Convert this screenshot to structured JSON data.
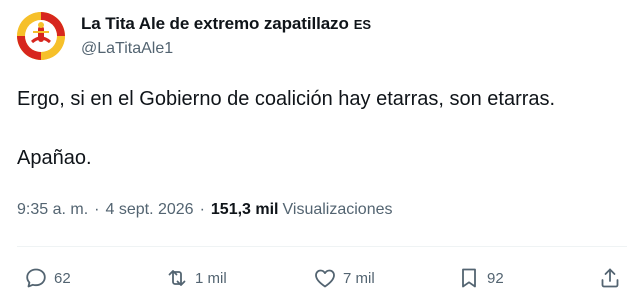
{
  "author": {
    "display_name": "La Tita Ale de extremo zapatillazo",
    "language_badge": "ES",
    "handle": "@LaTitaAle1"
  },
  "tweet": {
    "paragraphs": [
      "Ergo, si en el Gobierno de coalición hay etarras, son etarras.",
      "Apañao."
    ],
    "time": "9:35 a. m.",
    "separator": "·",
    "date": "4 sept. 2026",
    "views_count": "151,3 mil",
    "views_label": "Visualizaciones"
  },
  "actions": {
    "replies": "62",
    "reposts": "1 mil",
    "likes": "7 mil",
    "bookmarks": "92"
  },
  "icons": {
    "reply": "speech-bubble-icon",
    "repost": "repost-arrows-icon",
    "like": "heart-icon",
    "bookmark": "bookmark-icon",
    "share": "share-upload-icon"
  },
  "colors": {
    "text_primary": "#0f1419",
    "text_secondary": "#536471",
    "divider": "#eff3f4",
    "avatar_ring": "#f6c02a",
    "avatar_accent": "#d7261e"
  }
}
